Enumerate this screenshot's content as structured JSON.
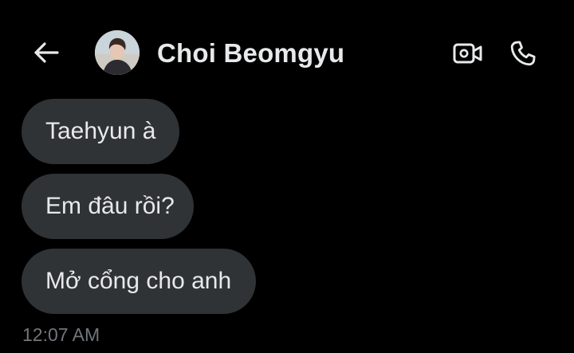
{
  "header": {
    "back_icon": "arrow-left-icon",
    "contact_name": "Choi Beomgyu",
    "video_icon": "video-call-icon",
    "call_icon": "phone-icon"
  },
  "messages": [
    {
      "text": "Taehyun à"
    },
    {
      "text": "Em đâu rồi?"
    },
    {
      "text": "Mở cổng cho anh"
    }
  ],
  "timestamp": "12:07 AM",
  "colors": {
    "background": "#000000",
    "bubble": "#2f3336",
    "text": "#e7e9ea",
    "muted": "#71767b"
  }
}
